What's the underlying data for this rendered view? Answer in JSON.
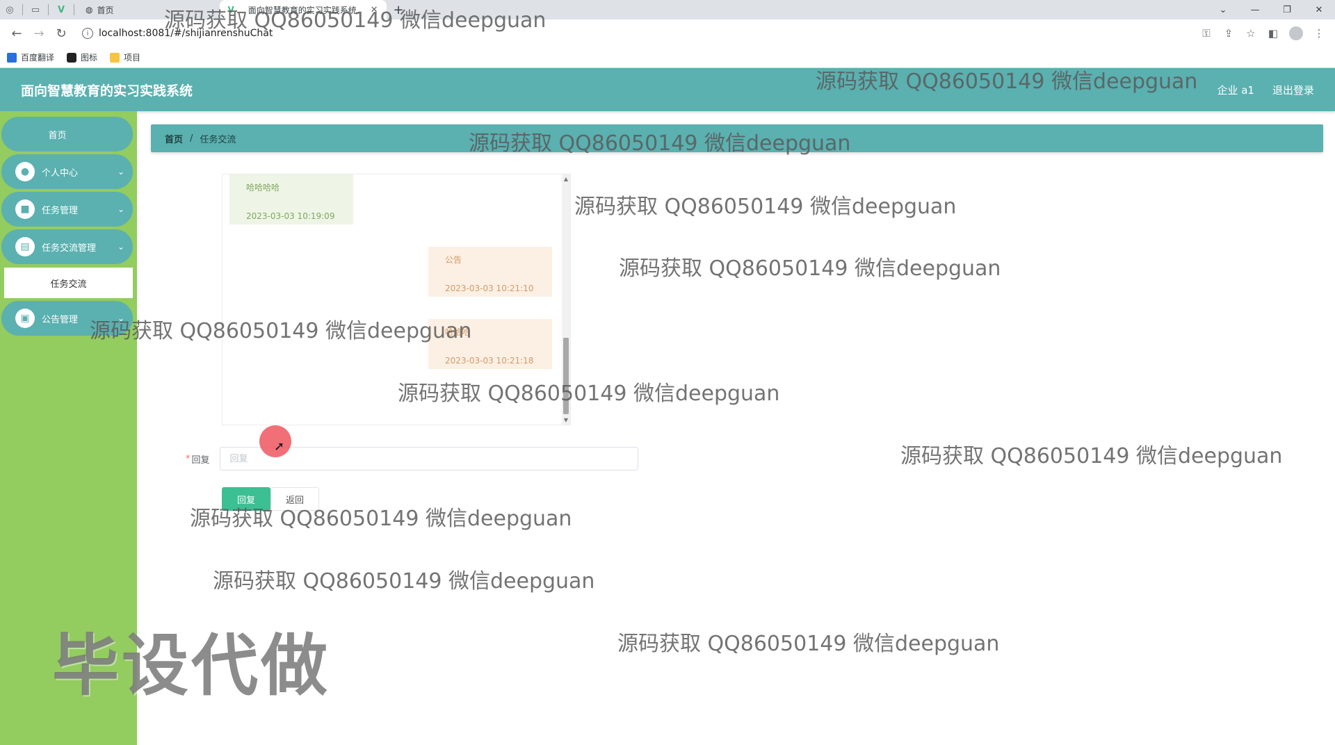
{
  "browser": {
    "tabs": [
      {
        "label": "首页",
        "active": false
      },
      {
        "label": "面向智慧教育的实习实践系统",
        "active": true
      }
    ],
    "url": "localhost:8081/#/shijianrenshuChat",
    "bookmarks": [
      {
        "label": "百度翻译",
        "icon": "translate-icon"
      },
      {
        "label": "图标",
        "icon": "image-icon"
      },
      {
        "label": "项目",
        "icon": "folder-icon"
      }
    ]
  },
  "header": {
    "title": "面向智慧教育的实习实践系统",
    "user": "企业 a1",
    "logout": "退出登录",
    "color": "#5bb0b0"
  },
  "sidebar": {
    "color": "#93cc5f",
    "items": [
      {
        "label": "首页"
      },
      {
        "label": "个人中心",
        "icon": "user-icon"
      },
      {
        "label": "任务管理",
        "icon": "briefcase-icon"
      },
      {
        "label": "任务交流管理",
        "icon": "document-icon",
        "expanded": true
      },
      {
        "label": "公告管理",
        "icon": "clipboard-icon"
      }
    ],
    "sub_item": "任务交流"
  },
  "breadcrumb": {
    "home": "首页",
    "separator": "/",
    "current": "任务交流"
  },
  "chat": {
    "messages": [
      {
        "side": "left",
        "text": "哈哈哈哈",
        "time": "2023-03-03 10:19:09"
      },
      {
        "side": "right",
        "text": "公告",
        "time": "2023-03-03 10:21:10"
      },
      {
        "side": "right",
        "text": "哈哈哈",
        "time": "2023-03-03 10:21:18"
      }
    ]
  },
  "form": {
    "reply_label": "回复",
    "reply_placeholder": "回复",
    "reply_value": "",
    "submit_label": "回复",
    "back_label": "返回",
    "primary_color": "#3cbf92"
  },
  "watermark": {
    "text": "源码获取 QQ86050149 微信deepguan",
    "big_text": "毕设代做"
  }
}
